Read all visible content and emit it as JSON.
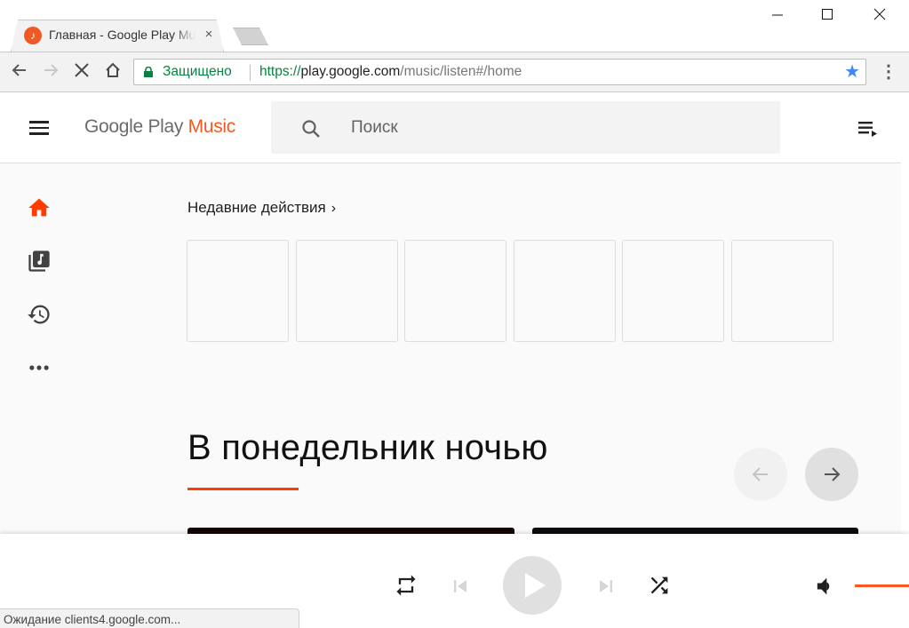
{
  "browser": {
    "tab": {
      "title": "Главная - Google Play Music",
      "favicon": "music-note-icon",
      "close_label": "×"
    },
    "window_controls": {
      "minimize": "—",
      "maximize": "☐",
      "close": "✕"
    },
    "nav": {
      "back": "←",
      "forward": "→",
      "stop": "✕",
      "home": "⌂"
    },
    "omnibox": {
      "security_label": "Защищено",
      "url_scheme": "https://",
      "url_host": "play.google.com",
      "url_path": "/music/listen#/home",
      "bookmark_icon": "★"
    },
    "menu_icon": "⋮",
    "status_text": "Ожидание clients4.google.com..."
  },
  "app": {
    "logo": {
      "part1": "Google Play",
      "part2": "Music"
    },
    "search": {
      "placeholder": "Поиск",
      "value": ""
    },
    "colors": {
      "accent": "#ef5a24",
      "underline": "#ff3d00",
      "secure": "#0b8043",
      "star": "#4285f4"
    },
    "sidebar": {
      "items": [
        {
          "name": "home",
          "icon": "home-icon",
          "active": true
        },
        {
          "name": "library",
          "icon": "music-library-icon",
          "active": false
        },
        {
          "name": "recents",
          "icon": "history-icon",
          "active": false
        },
        {
          "name": "more",
          "icon": "more-icon",
          "active": false
        }
      ]
    },
    "recent": {
      "title": "Недавние действия",
      "chevron": "›",
      "cards": [
        {},
        {},
        {},
        {},
        {},
        {}
      ]
    },
    "section": {
      "title": "В понедельник ночью",
      "prev_arrow": "←",
      "next_arrow": "→"
    },
    "player": {
      "repeat": "repeat-icon",
      "previous": "skip-previous-icon",
      "play": "play-icon",
      "next": "skip-next-icon",
      "shuffle": "shuffle-icon",
      "volume": "volume-icon",
      "volume_level_percent": 100
    }
  }
}
